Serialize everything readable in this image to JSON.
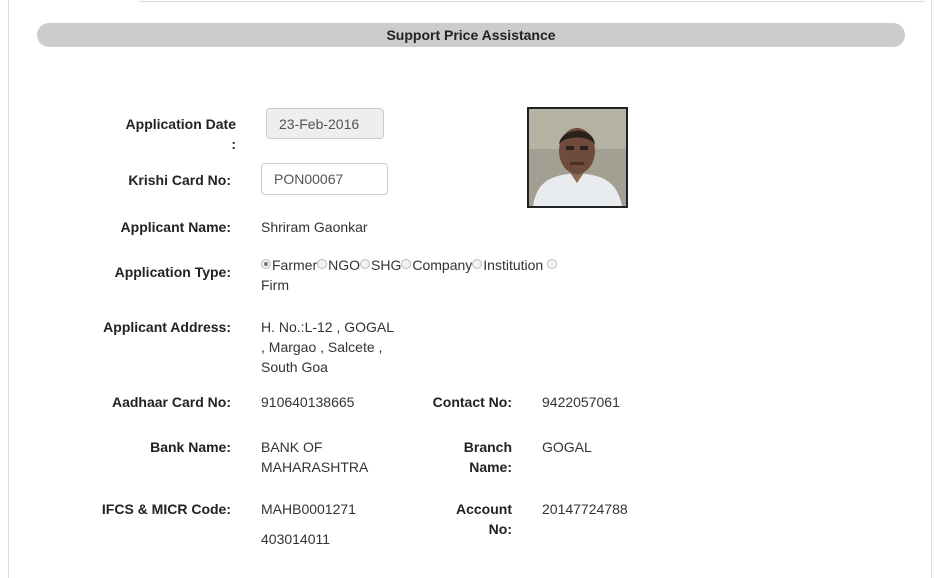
{
  "header": {
    "title": "Support Price Assistance"
  },
  "form": {
    "application_date": {
      "label": "Application Date",
      "colon": ":",
      "value": "23-Feb-2016"
    },
    "krishi_card": {
      "label": "Krishi Card No:",
      "value": "PON00067"
    },
    "applicant_name": {
      "label": "Applicant Name:",
      "value": "Shriram Gaonkar"
    },
    "application_type": {
      "label": "Application Type:",
      "options": [
        {
          "label": "Farmer",
          "checked": true
        },
        {
          "label": "NGO",
          "checked": false
        },
        {
          "label": "SHG",
          "checked": false
        },
        {
          "label": "Company",
          "checked": false
        },
        {
          "label": "Institution",
          "checked": false
        },
        {
          "label": "Firm",
          "checked": false
        }
      ]
    },
    "applicant_address": {
      "label": "Applicant Address:",
      "line1": "H. No.:L-12 , GOGAL",
      "line2": ", Margao , Salcete ,",
      "line3": "South Goa"
    },
    "aadhaar": {
      "label": "Aadhaar Card No:",
      "value": "910640138665"
    },
    "contact": {
      "label": "Contact No:",
      "value": "9422057061"
    },
    "bank_name": {
      "label": "Bank Name:",
      "line1": "BANK OF",
      "line2": "MAHARASHTRA"
    },
    "branch_name": {
      "label_line1": "Branch",
      "label_line2": "Name:",
      "value": "GOGAL"
    },
    "ifsc": {
      "label": "IFCS & MICR Code:",
      "ifsc_value": "MAHB0001271",
      "micr_value": "403014011"
    },
    "account": {
      "label_line1": "Account",
      "label_line2": "No:",
      "value": "20147724788"
    }
  },
  "photo": {
    "icon": "applicant-photo"
  }
}
